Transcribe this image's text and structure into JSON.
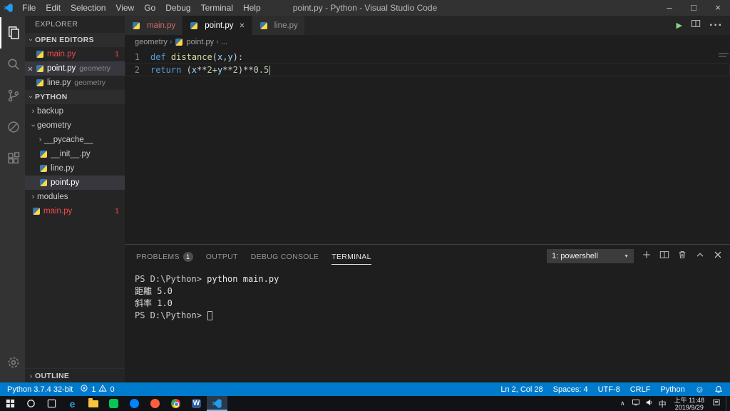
{
  "colors": {
    "accent": "#007acc",
    "error": "#f14c4c",
    "statusbar": "#007acc",
    "editor_bg": "#1e1e1e"
  },
  "title_bar": {
    "title": "point.py - Python - Visual Studio Code",
    "menus": [
      "File",
      "Edit",
      "Selection",
      "View",
      "Go",
      "Debug",
      "Terminal",
      "Help"
    ],
    "window_controls": {
      "minimize": "–",
      "maximize": "□",
      "close": "×"
    }
  },
  "activity_bar": {
    "items": [
      {
        "icon": "files",
        "active": true
      },
      {
        "icon": "search",
        "active": false
      },
      {
        "icon": "source-control",
        "active": false
      },
      {
        "icon": "debug",
        "active": false
      },
      {
        "icon": "extensions",
        "active": false
      }
    ],
    "bottom": [
      {
        "icon": "settings",
        "active": false
      }
    ]
  },
  "sidebar": {
    "title": "EXPLORER",
    "open_editors": {
      "header": "OPEN EDITORS",
      "items": [
        {
          "name": "main.py",
          "detail": "",
          "badge": "1",
          "error": true,
          "active": false
        },
        {
          "name": "point.py",
          "detail": "geometry",
          "badge": "",
          "error": false,
          "active": true
        },
        {
          "name": "line.py",
          "detail": "geometry",
          "badge": "",
          "error": false,
          "active": false
        }
      ]
    },
    "section": {
      "header": "PYTHON",
      "tree": [
        {
          "name": "backup",
          "kind": "folder",
          "expanded": false,
          "level": 0,
          "selected": false,
          "error": false,
          "badge": ""
        },
        {
          "name": "geometry",
          "kind": "folder",
          "expanded": true,
          "level": 0,
          "selected": false,
          "error": false,
          "badge": ""
        },
        {
          "name": "__pycache__",
          "kind": "folder",
          "expanded": false,
          "level": 1,
          "selected": false,
          "error": false,
          "badge": ""
        },
        {
          "name": "__init__.py",
          "kind": "file",
          "level": 1,
          "selected": false,
          "error": false,
          "badge": ""
        },
        {
          "name": "line.py",
          "kind": "file",
          "level": 1,
          "selected": false,
          "error": false,
          "badge": ""
        },
        {
          "name": "point.py",
          "kind": "file",
          "level": 1,
          "selected": true,
          "error": false,
          "badge": ""
        },
        {
          "name": "modules",
          "kind": "folder",
          "expanded": false,
          "level": 0,
          "selected": false,
          "error": false,
          "badge": ""
        },
        {
          "name": "main.py",
          "kind": "file",
          "level": 0,
          "selected": false,
          "error": true,
          "badge": "1"
        }
      ]
    },
    "outline_header": "OUTLINE"
  },
  "editor": {
    "tabs": [
      {
        "label": "main.py",
        "active": false,
        "error": true
      },
      {
        "label": "point.py",
        "active": true,
        "error": false
      },
      {
        "label": "line.py",
        "active": false,
        "error": false
      }
    ],
    "breadcrumb": [
      "geometry",
      "point.py",
      "..."
    ],
    "code": {
      "lines": [
        {
          "num": "1",
          "current": false,
          "tokens": [
            [
              "kw",
              "def"
            ],
            [
              "pl",
              " "
            ],
            [
              "fn",
              "distance"
            ],
            [
              "pl",
              "("
            ],
            [
              "pm",
              "x"
            ],
            [
              "pl",
              ","
            ],
            [
              "pm",
              "y"
            ],
            [
              "pl",
              "):"
            ]
          ]
        },
        {
          "num": "2",
          "current": true,
          "tokens": [
            [
              "pl",
              "    "
            ],
            [
              "kw",
              "return"
            ],
            [
              "pl",
              " ("
            ],
            [
              "pm",
              "x"
            ],
            [
              "pl",
              "**"
            ],
            [
              "nu",
              "2"
            ],
            [
              "pl",
              "+"
            ],
            [
              "pm",
              "y"
            ],
            [
              "pl",
              "**"
            ],
            [
              "nu",
              "2"
            ],
            [
              "pl",
              ")**"
            ],
            [
              "nu",
              "0.5"
            ]
          ]
        }
      ]
    }
  },
  "panel": {
    "tabs": [
      {
        "label": "PROBLEMS",
        "badge": "1",
        "active": false
      },
      {
        "label": "OUTPUT",
        "badge": "",
        "active": false
      },
      {
        "label": "DEBUG CONSOLE",
        "badge": "",
        "active": false
      },
      {
        "label": "TERMINAL",
        "badge": "",
        "active": true
      }
    ],
    "terminal_selector": "1: powershell",
    "terminal": {
      "lines": [
        {
          "cursor": false,
          "segments": [
            [
              "prompt",
              "PS D:\\Python> "
            ],
            [
              "cmd",
              "python main.py"
            ]
          ]
        },
        {
          "cursor": false,
          "segments": [
            [
              "out",
              "距離 5.0"
            ]
          ]
        },
        {
          "cursor": false,
          "segments": [
            [
              "out",
              "斜率 1.0"
            ]
          ]
        },
        {
          "cursor": true,
          "segments": [
            [
              "prompt",
              "PS D:\\Python> "
            ]
          ]
        }
      ]
    }
  },
  "status_bar": {
    "python_version": "Python 3.7.4 32-bit",
    "errors": "1",
    "warnings": "0",
    "right_items": [
      "Ln 2, Col 28",
      "Spaces: 4",
      "UTF-8",
      "CRLF",
      "Python"
    ]
  },
  "taskbar": {
    "apps": [
      {
        "icon": "windows-start",
        "color": "",
        "active": false
      },
      {
        "icon": "search",
        "color": "",
        "active": false
      },
      {
        "icon": "task-view",
        "color": "",
        "active": false
      },
      {
        "icon": "edge",
        "color": "#2f9ae3",
        "active": false
      },
      {
        "icon": "file-explorer",
        "color": "#f8c53a",
        "active": false
      },
      {
        "icon": "app-green",
        "color": "#06c755",
        "active": false
      },
      {
        "icon": "app-blue",
        "color": "#0084ff",
        "active": false
      },
      {
        "icon": "app-red",
        "color": "#ff5f3c",
        "active": false
      },
      {
        "icon": "chrome",
        "color": "",
        "active": false
      },
      {
        "icon": "word",
        "color": "#2b579a",
        "active": false
      },
      {
        "icon": "vscode",
        "color": "#1f9cf0",
        "active": true
      }
    ],
    "tray": {
      "ime_lang": "中",
      "time": "上午 11:48",
      "date": "2019/9/29"
    }
  }
}
